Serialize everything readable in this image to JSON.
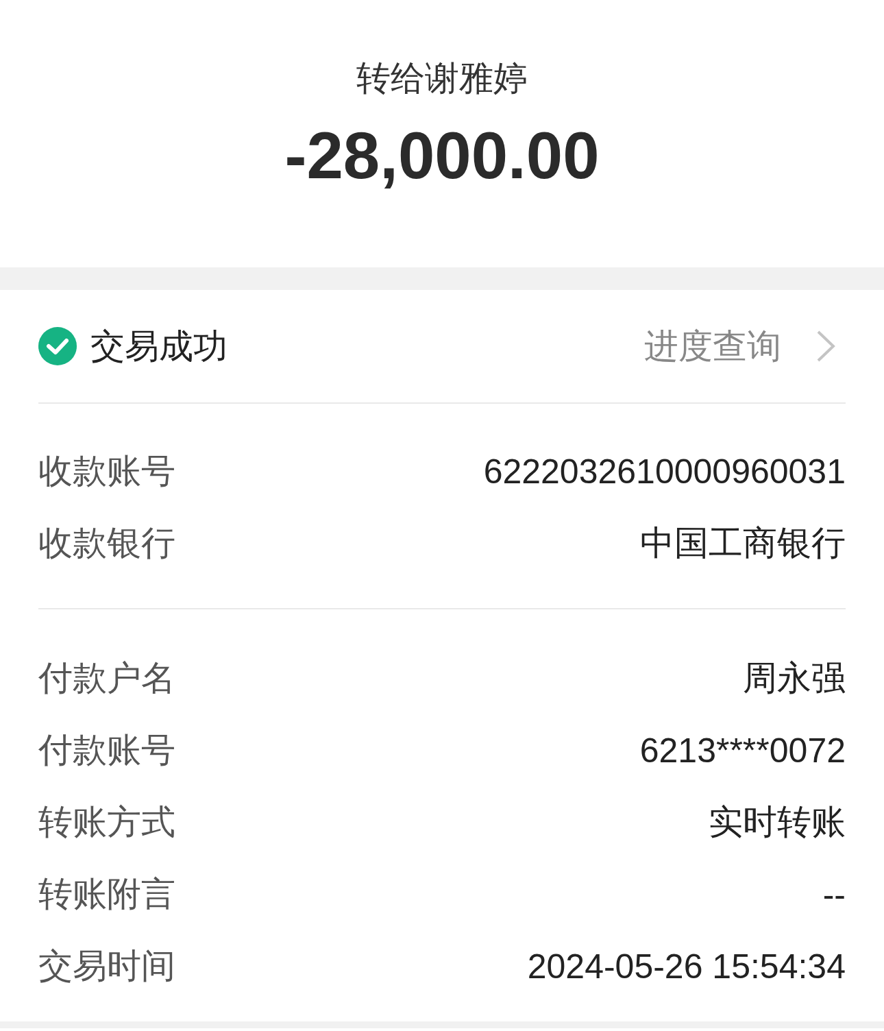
{
  "header": {
    "title": "转给谢雅婷",
    "amount": "-28,000.00"
  },
  "status": {
    "text": "交易成功",
    "success": true,
    "link": "进度查询"
  },
  "sections": [
    {
      "rows": [
        {
          "label": "收款账号",
          "value": "6222032610000960031"
        },
        {
          "label": "收款银行",
          "value": "中国工商银行"
        }
      ]
    },
    {
      "rows": [
        {
          "label": "付款户名",
          "value": "周永强"
        },
        {
          "label": "付款账号",
          "value": "6213****0072"
        },
        {
          "label": "转账方式",
          "value": "实时转账"
        },
        {
          "label": "转账附言",
          "value": "--"
        },
        {
          "label": "交易时间",
          "value": "2024-05-26 15:54:34"
        }
      ]
    }
  ]
}
